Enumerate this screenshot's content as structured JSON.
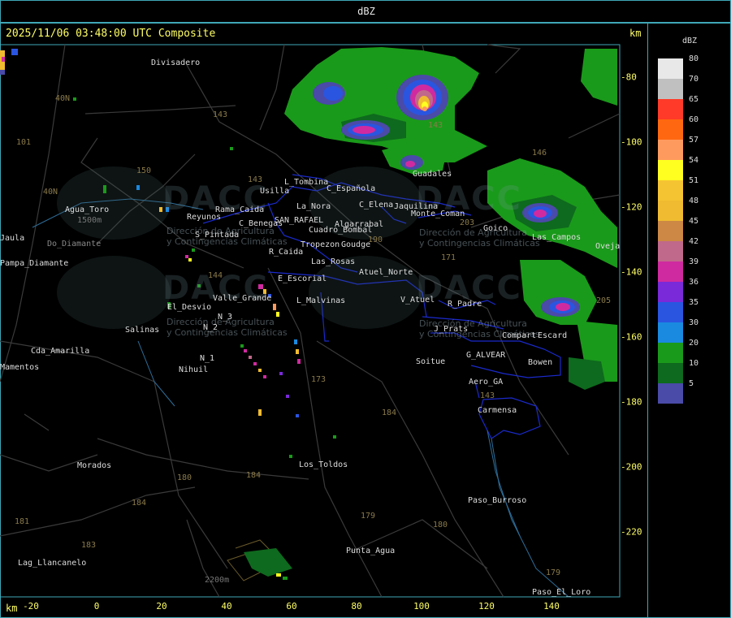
{
  "header": {
    "title": "dBZ"
  },
  "timestamp": "2025/11/06 03:48:00 UTC Composite",
  "axis": {
    "unit_top": "km",
    "unit_bottom": "km",
    "x_ticks": [
      "-20",
      "0",
      "20",
      "40",
      "60",
      "80",
      "100",
      "120",
      "140"
    ],
    "y_ticks": [
      "-80",
      "-100",
      "-120",
      "-140",
      "-160",
      "-180",
      "-200",
      "-220"
    ]
  },
  "legend": {
    "units": "dBZ",
    "levels": [
      {
        "label": "80",
        "color": "#e8e8e8"
      },
      {
        "label": "70",
        "color": "#c0c0c0"
      },
      {
        "label": "65",
        "color": "#ff3a28"
      },
      {
        "label": "60",
        "color": "#ff6810"
      },
      {
        "label": "57",
        "color": "#ff9a5e"
      },
      {
        "label": "54",
        "color": "#ffff20"
      },
      {
        "label": "51",
        "color": "#f5c432"
      },
      {
        "label": "48",
        "color": "#f0bb30"
      },
      {
        "label": "45",
        "color": "#cc8844"
      },
      {
        "label": "42",
        "color": "#c0698a"
      },
      {
        "label": "39",
        "color": "#d02aa0"
      },
      {
        "label": "36",
        "color": "#7a2ad8"
      },
      {
        "label": "35",
        "color": "#2a55e0"
      },
      {
        "label": "30",
        "color": "#1a8ae0"
      },
      {
        "label": "20",
        "color": "#1a9a1a"
      },
      {
        "label": "10",
        "color": "#0e6a1e"
      },
      {
        "label": "5",
        "color": "#4a4aa8"
      }
    ]
  },
  "places": [
    "Divisadero",
    "Agua_Toro",
    "Reyunos",
    "Rama_Caida",
    "S_Pintada",
    "Usilla",
    "L_Tombina",
    "C_Española",
    "La_Nora",
    "C_Benegas",
    "SAN_RAFAEL",
    "Cuadro_Bombal",
    "Algarrabal",
    "C_Elena",
    "Jaquilina",
    "Monte_Coman",
    "Tropezon",
    "Goudge",
    "R_Caida",
    "Las_Rosas",
    "Atuel_Norte",
    "E_Escorial",
    "L_Malvinas",
    "Valle_Grande",
    "El_Desvio",
    "N_3",
    "N_2",
    "N_1",
    "Nihuil",
    "Salinas",
    "Cda_Amarilla",
    "Pampa_Diamante",
    "Guadales",
    "Goico",
    "Las_Campos",
    "Oveja",
    "V_Atuel",
    "R_Padre",
    "J_Prats",
    "Compart",
    "Escard",
    "G_ALVEAR",
    "Soitue",
    "Bowen",
    "Aero_GA",
    "Carmensa",
    "Los_Toldos",
    "Morados",
    "Paso_Burroso",
    "Punta_Agua",
    "Lag_Llancanelo",
    "Paso_El_Loro",
    "Mamentos",
    "Jaula",
    "Do_Diamante"
  ],
  "routes": [
    "40N",
    "101",
    "143",
    "150",
    "143",
    "40N",
    "144",
    "173",
    "184",
    "180",
    "184",
    "184",
    "183",
    "179",
    "180",
    "181",
    "171",
    "203",
    "143",
    "146",
    "205",
    "190",
    "143",
    "179"
  ],
  "elevations": [
    "1500m",
    "2200m"
  ],
  "watermark": {
    "brand": "DACC",
    "org_line1": "Dirección de Agricultura",
    "org_line2": "y Contingencias Climáticas"
  }
}
